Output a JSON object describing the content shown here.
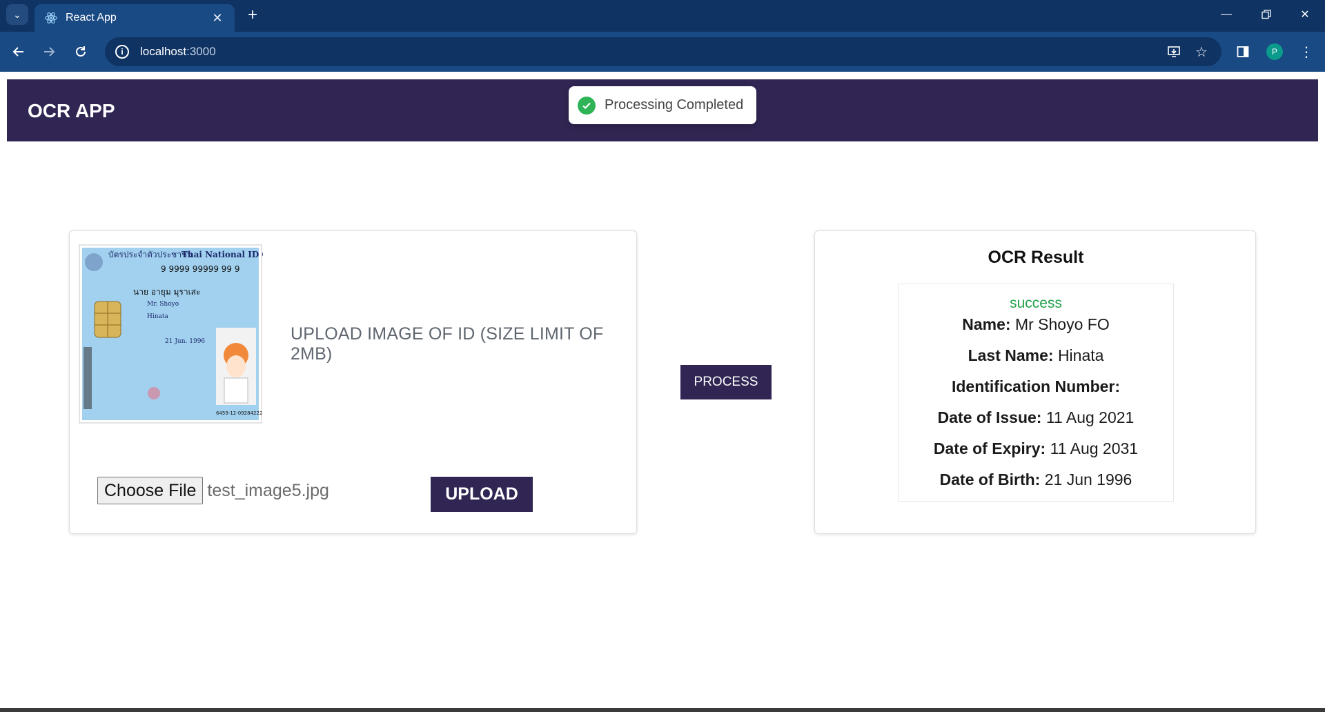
{
  "browser": {
    "tab_title": "React App",
    "url_host": "localhost",
    "url_port": ":3000",
    "profile_initial": "P"
  },
  "app": {
    "title": "OCR APP",
    "toast_message": "Processing Completed",
    "upload": {
      "label": "UPLOAD IMAGE OF ID (SIZE LIMIT OF 2MB)",
      "choose_file_label": "Choose File",
      "file_name": "test_image5.jpg",
      "upload_button": "UPLOAD"
    },
    "process_button": "PROCESS",
    "result": {
      "title": "OCR Result",
      "status": "success",
      "fields": [
        {
          "label": "Name:",
          "value": "Mr Shoyo FO"
        },
        {
          "label": "Last Name:",
          "value": "Hinata"
        },
        {
          "label": "Identification Number:",
          "value": ""
        },
        {
          "label": "Date of Issue:",
          "value": "11 Aug 2021"
        },
        {
          "label": "Date of Expiry:",
          "value": "11 Aug 2031"
        },
        {
          "label": "Date of Birth:",
          "value": "21 Jun 1996"
        }
      ]
    },
    "id_card_image": {
      "header_thai": "บัตรประจำตัวประชาชน",
      "header_en": "Thai National ID Card",
      "id_number": "9 9999 99999 99 9",
      "name_thai": "นาย อายุม มุราเสะ",
      "name_en": "Mr. Shoyo",
      "last_name_en": "Hinata",
      "dob_en": "21 Jun. 1996",
      "serial": "6459-12-09284222"
    },
    "colors": {
      "brand": "#312653",
      "success": "#2eb356"
    }
  }
}
